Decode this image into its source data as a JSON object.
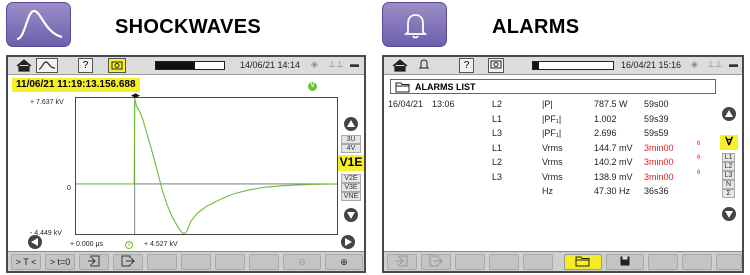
{
  "left_section": {
    "title": "SHOCKWAVES",
    "icon": "shockwave-icon",
    "statusbar": {
      "datetime": "14/06/21 14:14",
      "progress": 0.58,
      "buttons": [
        "home-icon",
        "waveform-mode-icon",
        "help-icon",
        "camera-icon"
      ]
    },
    "capture": {
      "timestamp": "11/06/21  11:19:13.156.688",
      "badge": "V"
    },
    "plot": {
      "y_max_label": "+ 7.637 kV",
      "y_zero_label": "0",
      "y_min_label": "- 4.449 kV",
      "cursor_time": "+ 0.000 µs",
      "cursor_badge": "V",
      "cursor_value": "+ 4.527 kV"
    },
    "modes": {
      "top": [
        "3U",
        "4V"
      ],
      "selected": "V1E",
      "bottom": [
        "V2E",
        "V3E",
        "VNE"
      ]
    },
    "bottom_buttons": [
      "> T <",
      "> t=0",
      "",
      "",
      "",
      "",
      "",
      "",
      "",
      ""
    ]
  },
  "right_section": {
    "title": "ALARMS",
    "icon": "bell-icon",
    "statusbar": {
      "datetime": "16/04/21 15:16",
      "progress": 0.07,
      "buttons": [
        "home-icon",
        "bell-icon",
        "help-icon",
        "camera-icon"
      ]
    },
    "list_title": "ALARMS LIST",
    "rows": [
      {
        "date": "16/04/21",
        "time": "13:06",
        "phase": "L2",
        "param": "|P|",
        "value": "787.5 W",
        "duration": "59s00",
        "red": false,
        "mark": ""
      },
      {
        "date": "",
        "time": "",
        "phase": "L1",
        "param": "|PF₁|",
        "value": "1.002",
        "duration": "59s39",
        "red": false,
        "mark": ""
      },
      {
        "date": "",
        "time": "",
        "phase": "L3",
        "param": "|PF₁|",
        "value": "2.696",
        "duration": "59s59",
        "red": false,
        "mark": ""
      },
      {
        "date": "",
        "time": "",
        "phase": "L1",
        "param": "Vrms",
        "value": "144.7 mV",
        "duration": "3min00",
        "red": true,
        "mark": "6"
      },
      {
        "date": "",
        "time": "",
        "phase": "L2",
        "param": "Vrms",
        "value": "140.2 mV",
        "duration": "3min00",
        "red": true,
        "mark": "6"
      },
      {
        "date": "",
        "time": "",
        "phase": "L3",
        "param": "Vrms",
        "value": "138.9 mV",
        "duration": "3min00",
        "red": true,
        "mark": "6"
      },
      {
        "date": "",
        "time": "",
        "phase": "",
        "param": "Hz",
        "value": "47.30 Hz",
        "duration": "36s36",
        "red": false,
        "mark": ""
      }
    ],
    "filter": {
      "selected": "∀",
      "options": [
        "L1",
        "L2",
        "L3",
        "N",
        "Σ"
      ]
    }
  },
  "colors": {
    "icon_bg": "#7b6db8",
    "highlight": "#f7ef2b",
    "trace": "#6dbf3a",
    "alarm_red": "#e02020"
  },
  "waveform": {
    "x_range": [
      0,
      100
    ],
    "y_range": [
      -4.449,
      7.637
    ],
    "t0": 22.5,
    "points": [
      [
        0,
        0
      ],
      [
        22.3,
        0
      ],
      [
        22.5,
        7.6
      ],
      [
        23.2,
        6.9
      ],
      [
        24.2,
        6.5
      ],
      [
        25.5,
        5.8
      ],
      [
        27,
        4.6
      ],
      [
        29,
        3.0
      ],
      [
        31,
        1.3
      ],
      [
        33,
        -0.5
      ],
      [
        35,
        -1.9
      ],
      [
        37,
        -3.0
      ],
      [
        39,
        -3.8
      ],
      [
        40.5,
        -4.3
      ],
      [
        41.5,
        -4.45
      ],
      [
        42.5,
        -4.2
      ],
      [
        44,
        -3.3
      ],
      [
        46.5,
        -2.6
      ],
      [
        50,
        -2.0
      ],
      [
        55,
        -1.4
      ],
      [
        60,
        -0.9
      ],
      [
        66,
        -0.55
      ],
      [
        72,
        -0.3
      ],
      [
        80,
        -0.15
      ],
      [
        90,
        -0.05
      ],
      [
        100,
        0
      ]
    ]
  }
}
